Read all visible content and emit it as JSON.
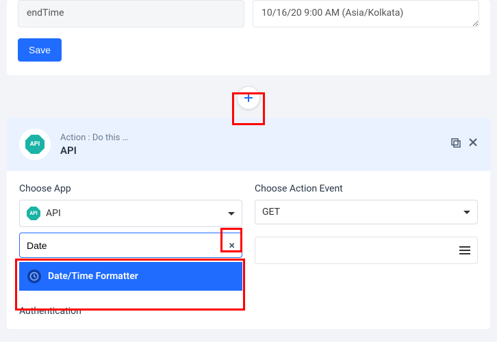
{
  "topFields": {
    "left": "endTime",
    "right": "10/16/20 9:00 AM (Asia/Kolkata)"
  },
  "buttons": {
    "save": "Save"
  },
  "action": {
    "subtitle": "Action : Do this …",
    "title": "API"
  },
  "form": {
    "chooseAppLabel": "Choose App",
    "chooseAppValue": "API",
    "chooseActionLabel": "Choose Action Event",
    "chooseActionValue": "GET",
    "searchValue": "Date",
    "dropdownOption": "Date/Time Formatter",
    "authLabel": "Authentication"
  }
}
